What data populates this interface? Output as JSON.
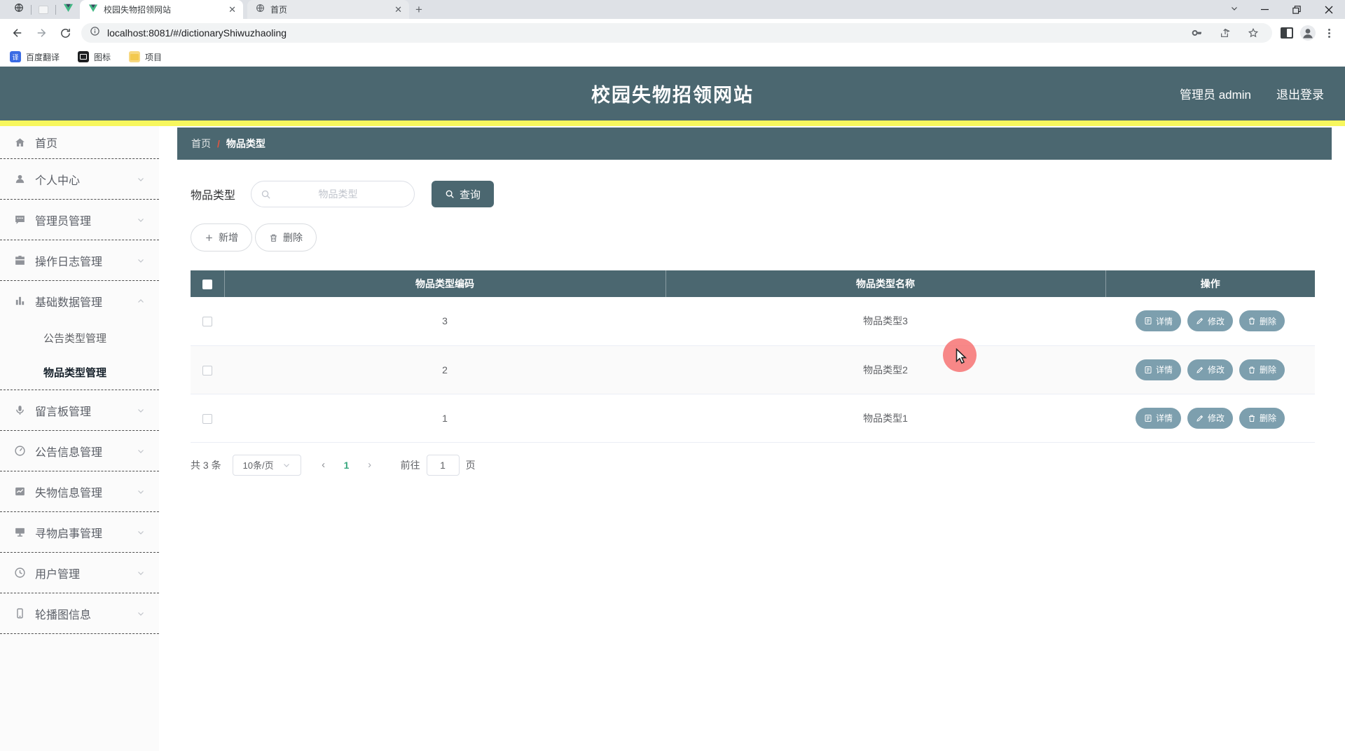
{
  "browser": {
    "tabs": [
      {
        "title": "校园失物招领网站"
      },
      {
        "title": "首页"
      }
    ],
    "url": "localhost:8081/#/dictionaryShiwuzhaoling",
    "bookmarks": [
      {
        "label": "百度翻译"
      },
      {
        "label": "图标"
      },
      {
        "label": "项目"
      }
    ]
  },
  "header": {
    "title": "校园失物招领网站",
    "admin_label": "管理员 admin",
    "logout_label": "退出登录"
  },
  "sidebar": {
    "items": [
      {
        "label": "首页"
      },
      {
        "label": "个人中心"
      },
      {
        "label": "管理员管理"
      },
      {
        "label": "操作日志管理"
      },
      {
        "label": "基础数据管理"
      },
      {
        "label": "公告类型管理"
      },
      {
        "label": "物品类型管理"
      },
      {
        "label": "留言板管理"
      },
      {
        "label": "公告信息管理"
      },
      {
        "label": "失物信息管理"
      },
      {
        "label": "寻物启事管理"
      },
      {
        "label": "用户管理"
      },
      {
        "label": "轮播图信息"
      }
    ]
  },
  "breadcrumb": {
    "home": "首页",
    "separator": "/",
    "current": "物品类型"
  },
  "search": {
    "label": "物品类型",
    "placeholder": "物品类型",
    "button": "查询"
  },
  "toolbar": {
    "add": "新增",
    "delete": "删除"
  },
  "table": {
    "columns": {
      "code": "物品类型编码",
      "name": "物品类型名称",
      "actions": "操作"
    },
    "rows": [
      {
        "code": "3",
        "name": "物品类型3"
      },
      {
        "code": "2",
        "name": "物品类型2"
      },
      {
        "code": "1",
        "name": "物品类型1"
      }
    ],
    "row_actions": {
      "detail": "详情",
      "edit": "修改",
      "delete": "删除"
    }
  },
  "pagination": {
    "total": "共 3 条",
    "page_size": "10条/页",
    "current_page": "1",
    "goto": "前往",
    "goto_value": "1",
    "unit": "页"
  },
  "colors": {
    "theme_teal": "#4B6770",
    "accent_yellow": "#F7F75D",
    "action_button": "#7D9FAE",
    "active_page_green": "#38A77E",
    "breadcrumb_slash_red": "#E4543F",
    "cursor_highlight": "#F56C6C"
  }
}
